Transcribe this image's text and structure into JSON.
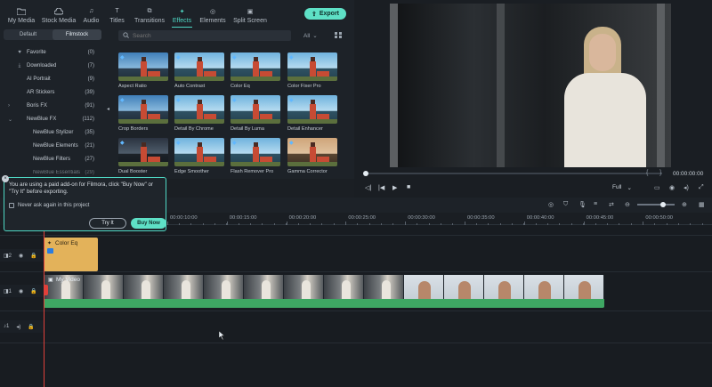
{
  "toolbar": {
    "tabs": [
      {
        "label": "My Media",
        "icon": "folder-icon"
      },
      {
        "label": "Stock Media",
        "icon": "cloud-icon"
      },
      {
        "label": "Audio",
        "icon": "music-note-icon"
      },
      {
        "label": "Titles",
        "icon": "text-icon"
      },
      {
        "label": "Transitions",
        "icon": "transition-icon"
      },
      {
        "label": "Effects",
        "icon": "sparkle-icon",
        "active": true
      },
      {
        "label": "Elements",
        "icon": "element-icon"
      },
      {
        "label": "Split Screen",
        "icon": "split-screen-icon"
      }
    ],
    "export_label": "Export"
  },
  "sidebar": {
    "subtabs": [
      "Default",
      "Filmstock"
    ],
    "active_subtab": "Filmstock",
    "items": [
      {
        "label": "Favorite",
        "count": "(0)",
        "icon": "heart-icon"
      },
      {
        "label": "Downloaded",
        "count": "(7)",
        "icon": "download-icon"
      },
      {
        "label": "AI Portrait",
        "count": "(9)"
      },
      {
        "label": "AR Stickers",
        "count": "(39)"
      },
      {
        "label": "Boris FX",
        "count": "(91)",
        "expandable": true
      },
      {
        "label": "NewBlue FX",
        "count": "(112)",
        "expandable": true,
        "expanded": true
      },
      {
        "label": "NewBlue Stylizer",
        "count": "(35)"
      },
      {
        "label": "NewBlue Elements",
        "count": "(21)"
      },
      {
        "label": "NewBlue Filters",
        "count": "(27)"
      },
      {
        "label": "NewBlue Essentials",
        "count": "(29)"
      }
    ]
  },
  "effects": {
    "search_placeholder": "Search",
    "filter_label": "All",
    "items": [
      {
        "label": "Aspect Ratio",
        "style": "blue"
      },
      {
        "label": "Auto Contrast",
        "style": "cool"
      },
      {
        "label": "Color Eq",
        "style": "cool"
      },
      {
        "label": "Color Fixer Pro",
        "style": "cool"
      },
      {
        "label": "Crop Borders",
        "style": "blue"
      },
      {
        "label": "Detail By Chrome",
        "style": "cool"
      },
      {
        "label": "Detail By Luma",
        "style": "cool"
      },
      {
        "label": "Detail Enhancer",
        "style": "cool"
      },
      {
        "label": "Dual Booster",
        "style": "dark"
      },
      {
        "label": "Edge Smoother",
        "style": "cool"
      },
      {
        "label": "Flash Remover Pro",
        "style": "cool"
      },
      {
        "label": "Gamma Corrector",
        "style": "warm"
      },
      {
        "label": "",
        "style": "cool"
      },
      {
        "label": "",
        "style": "cool"
      },
      {
        "label": "",
        "style": "cool"
      },
      {
        "label": "",
        "style": "cool"
      }
    ]
  },
  "preview": {
    "timecode": "00:00:00:00",
    "quality": "Full",
    "progress": 0
  },
  "popup": {
    "message": "You are using a paid add-on for Filmora, click \"Buy Now\" or \"Try It\" before exporting.",
    "checkbox_label": "Never ask again in this project",
    "try_label": "Try It",
    "buy_label": "Buy Now"
  },
  "timeline": {
    "ruler_labels": [
      "00:00:10:00",
      "00:00:15:00",
      "00:00:20:00",
      "00:00:25:00",
      "00:00:30:00",
      "00:00:35:00",
      "00:00:40:00",
      "00:00:45:00",
      "00:00:50:00"
    ],
    "tracks": [
      {
        "label": "2",
        "icon": "effect-track-icon"
      },
      {
        "label": "1",
        "icon": "video-track-icon"
      },
      {
        "label": "1",
        "icon": "audio-track-icon"
      }
    ],
    "effect_clip_title": "Color Eq",
    "video_clip_title": "My Video"
  },
  "colors": {
    "accent": "#5ee0c6",
    "effect_clip": "#e3b25a",
    "audio_wave": "#3ea763",
    "playhead": "#e0403a"
  }
}
